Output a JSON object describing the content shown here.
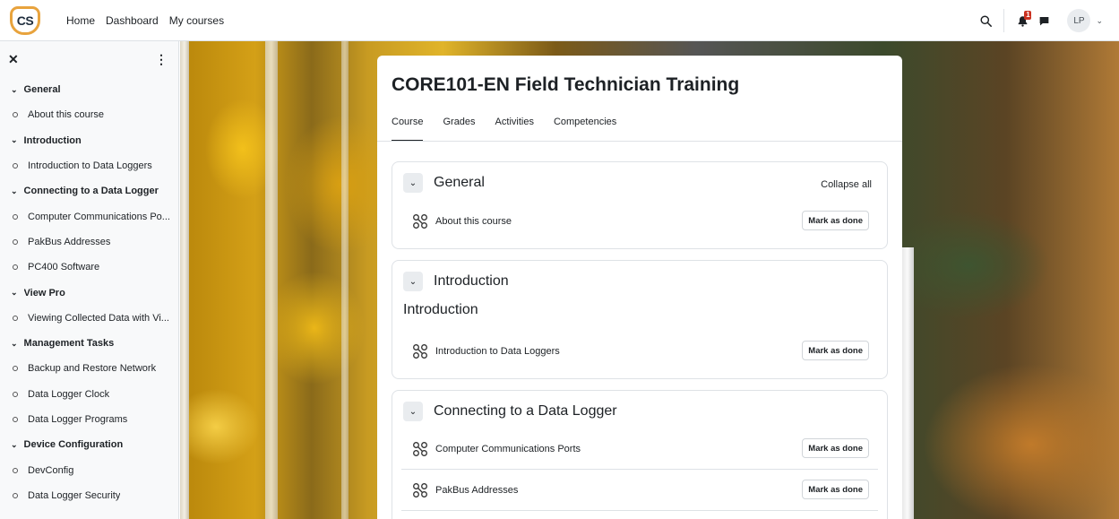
{
  "navbar": {
    "logo_text": "CS",
    "links": [
      "Home",
      "Dashboard",
      "My courses"
    ],
    "notification_count": "1",
    "user_initials": "LP"
  },
  "sidebar": {
    "items": [
      {
        "type": "section",
        "label": "General"
      },
      {
        "type": "activity",
        "label": "About this course"
      },
      {
        "type": "section",
        "label": "Introduction"
      },
      {
        "type": "activity",
        "label": "Introduction to Data Loggers"
      },
      {
        "type": "section",
        "label": "Connecting to a Data Logger"
      },
      {
        "type": "activity",
        "label": "Computer Communications Po..."
      },
      {
        "type": "activity",
        "label": "PakBus Addresses"
      },
      {
        "type": "activity",
        "label": "PC400 Software"
      },
      {
        "type": "section",
        "label": "View Pro"
      },
      {
        "type": "activity",
        "label": "Viewing Collected Data with Vi..."
      },
      {
        "type": "section",
        "label": "Management Tasks"
      },
      {
        "type": "activity",
        "label": "Backup and Restore Network"
      },
      {
        "type": "activity",
        "label": "Data Logger Clock"
      },
      {
        "type": "activity",
        "label": "Data Logger Programs"
      },
      {
        "type": "section",
        "label": "Device Configuration"
      },
      {
        "type": "activity",
        "label": "DevConfig"
      },
      {
        "type": "activity",
        "label": "Data Logger Security"
      }
    ]
  },
  "course": {
    "title": "CORE101-EN Field Technician Training",
    "tabs": [
      "Course",
      "Grades",
      "Activities",
      "Competencies"
    ],
    "active_tab": "Course",
    "collapse_all_label": "Collapse all",
    "mark_done_label": "Mark as done",
    "sections": [
      {
        "title": "General",
        "subtitle": "",
        "activities": [
          "About this course"
        ]
      },
      {
        "title": "Introduction",
        "subtitle": "Introduction",
        "activities": [
          "Introduction to Data Loggers"
        ]
      },
      {
        "title": "Connecting to a Data Logger",
        "subtitle": "",
        "activities": [
          "Computer Communications Ports",
          "PakBus Addresses"
        ]
      }
    ]
  }
}
